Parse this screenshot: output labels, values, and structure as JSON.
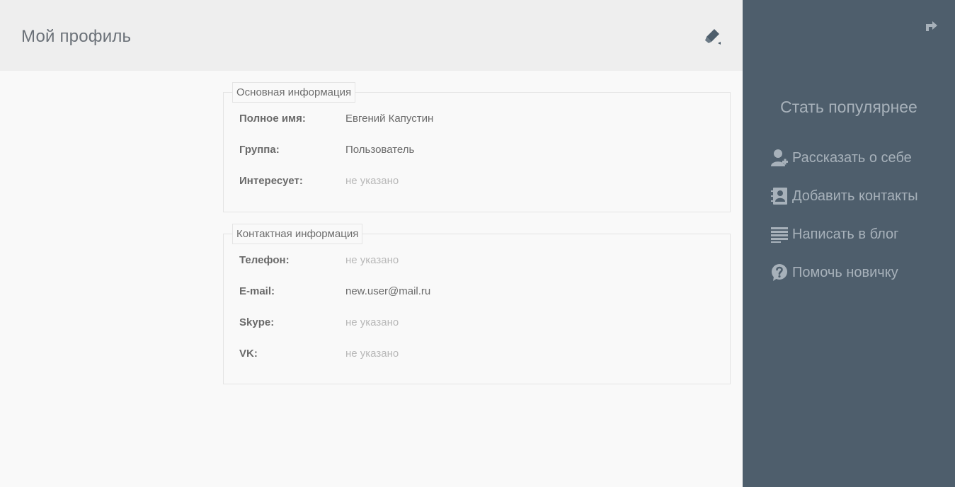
{
  "header": {
    "title": "Мой профиль",
    "edit_icon": "pencil-icon"
  },
  "sections": {
    "basic": {
      "legend": "Основная информация",
      "rows": [
        {
          "label": "Полное имя:",
          "value": "Евгений Капустин",
          "empty": false
        },
        {
          "label": "Группа:",
          "value": "Пользователь",
          "empty": false
        },
        {
          "label": "Интересует:",
          "value": "не указано",
          "empty": true
        }
      ]
    },
    "contact": {
      "legend": "Контактная информация",
      "rows": [
        {
          "label": "Телефон:",
          "value": "не указано",
          "empty": true
        },
        {
          "label": "E-mail:",
          "value": "new.user@mail.ru",
          "empty": false
        },
        {
          "label": "Skype:",
          "value": "не указано",
          "empty": true
        },
        {
          "label": "VK:",
          "value": "не указано",
          "empty": true
        }
      ]
    }
  },
  "sidebar": {
    "title": "Стать популярнее",
    "share_icon": "share-arrow-icon",
    "items": [
      {
        "label": "Рассказать о себе",
        "icon": "add-user-icon"
      },
      {
        "label": "Добавить контакты",
        "icon": "contact-book-icon"
      },
      {
        "label": "Написать в блог",
        "icon": "text-lines-icon"
      },
      {
        "label": "Помочь новичку",
        "icon": "question-bubble-icon"
      }
    ]
  },
  "colors": {
    "header_bg": "#eeeeee",
    "sidebar_bg": "#4e5e6c",
    "sidebar_text": "#a7b1ba",
    "edit_icon": "#4e5e6c"
  }
}
